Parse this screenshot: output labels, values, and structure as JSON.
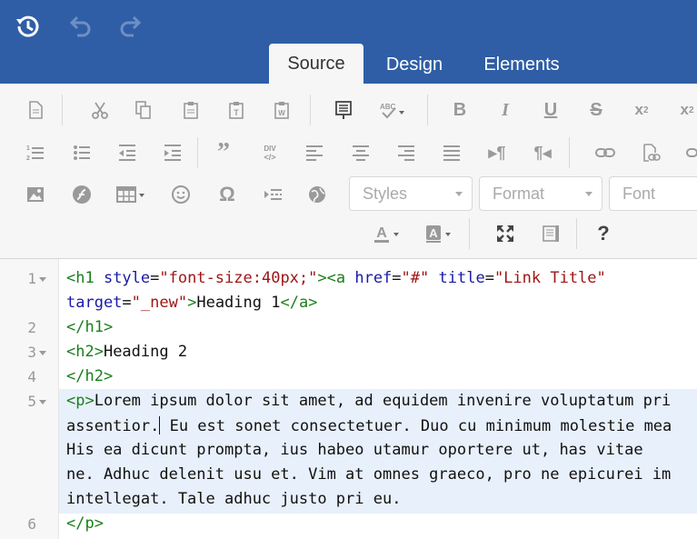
{
  "topbar": {
    "icons": [
      "history-icon",
      "undo-icon",
      "redo-icon"
    ],
    "tabs": [
      {
        "label": "Source",
        "active": true
      },
      {
        "label": "Design",
        "active": false
      },
      {
        "label": "Elements",
        "active": false
      }
    ],
    "color": "#2f5ea6"
  },
  "toolbar": {
    "row1": [
      "new-page-icon",
      "cut-icon",
      "copy-icon",
      "paste-icon",
      "paste-text-icon",
      "paste-word-icon",
      "templates-icon",
      "spellcheck-icon",
      "bold-icon",
      "italic-icon",
      "underline-icon",
      "strikethrough-icon",
      "subscript-icon",
      "superscript-icon"
    ],
    "row2": [
      "numbered-list-icon",
      "bulleted-list-icon",
      "decrease-indent-icon",
      "increase-indent-icon",
      "blockquote-icon",
      "div-container-icon",
      "align-left-icon",
      "align-center-icon",
      "align-right-icon",
      "justify-icon",
      "text-direction-ltr-icon",
      "text-direction-rtl-icon",
      "link-icon",
      "anchor-icon",
      "unlink-icon"
    ],
    "row3": [
      "image-icon",
      "flash-icon",
      "table-icon",
      "smiley-icon",
      "special-char-icon",
      "page-break-icon",
      "iframe-icon"
    ],
    "combos": {
      "styles": "Styles",
      "format": "Format",
      "font": "Font"
    },
    "row4": [
      "text-color-icon",
      "background-color-icon",
      "maximize-icon",
      "show-blocks-icon",
      "help-icon"
    ]
  },
  "editor": {
    "line_numbers": [
      "1",
      "2",
      "3",
      "4",
      "5",
      "6"
    ],
    "lines": {
      "l1a_tag": "<h1",
      "l1a_attr": " style",
      "l1a_eq": "=",
      "l1a_str": "\"font-size:40px;\"",
      "l1a_tag2": "><a",
      "l1a_attr2": " href",
      "l1a_eq2": "=",
      "l1a_str2": "\"#\"",
      "l1a_attr3": " title",
      "l1a_eq3": "=",
      "l1a_str3": "\"Link Title\"",
      "l1b_attr": "target",
      "l1b_eq": "=",
      "l1b_str": "\"_new\"",
      "l1b_tag": ">",
      "l1b_text": "Heading 1",
      "l1b_tag2": "</a>",
      "l2_tag": "</h1>",
      "l3_tag": "<h2>",
      "l3_text": "Heading 2",
      "l4_tag": "</h2>",
      "l5a_tag": "<p>",
      "l5a_text": "Lorem ipsum dolor sit amet, ad equidem invenire voluptatum pri",
      "l5b_text1": "assentior.",
      "l5b_text2": " Eu est sonet consectetuer. Duo cu minimum molestie mea",
      "l5c_text": "His ea dicunt prompta, ius habeo utamur oportere ut, has vitae",
      "l5d_text": "ne. Adhuc delenit usu et. Vim at omnes graeco, pro ne epicurei im",
      "l5e_text": "intellegat. Tale adhuc justo pri eu.",
      "l6_tag": "</p>"
    }
  }
}
